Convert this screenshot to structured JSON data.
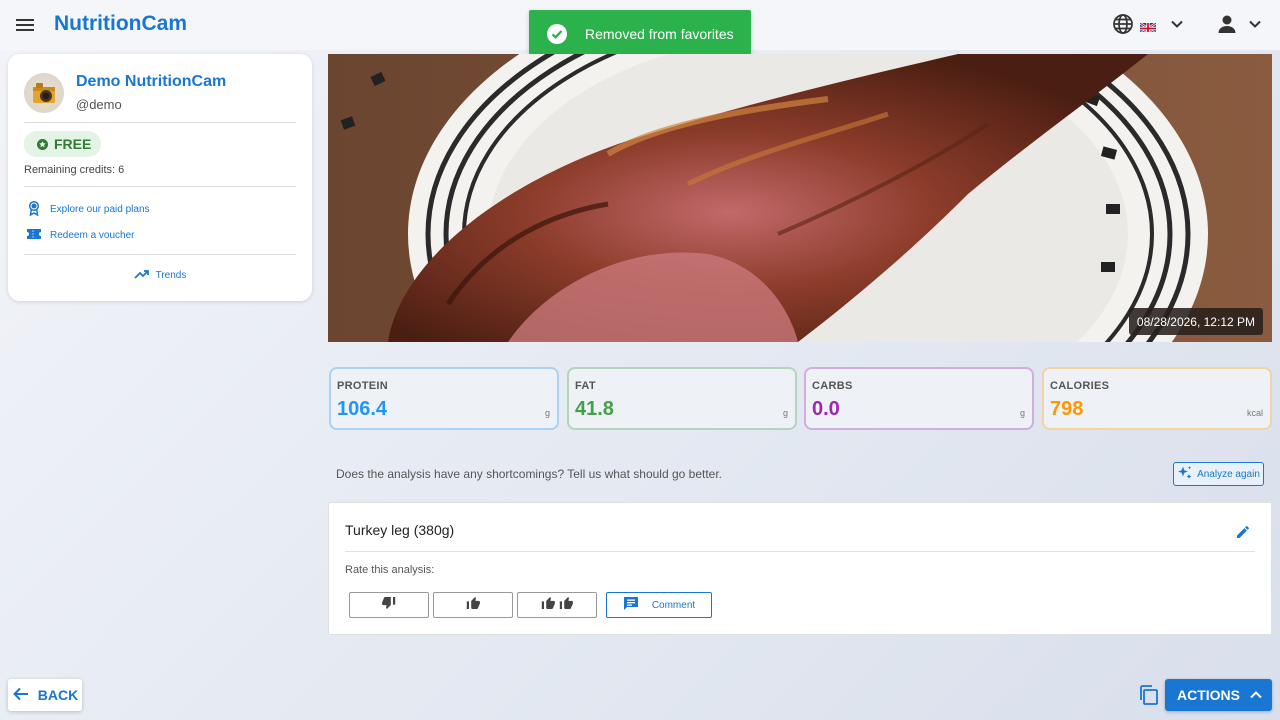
{
  "app": {
    "brand": "NutritionCam"
  },
  "toast": {
    "message": "Removed from favorites",
    "color": "#2bb24c"
  },
  "header": {
    "language_icon": "globe-icon",
    "language_flag": "uk-flag",
    "account_icon": "person-icon"
  },
  "profile": {
    "name": "Demo NutritionCam",
    "handle": "@demo",
    "plan": "FREE",
    "credits": "Remaining credits: 6",
    "links": [
      {
        "label": "Explore our paid plans",
        "icon": "award-icon"
      },
      {
        "label": "Redeem a voucher",
        "icon": "ticket-icon"
      }
    ],
    "trends": "Trends"
  },
  "photo": {
    "timestamp": "08/28/2026, 12:12 PM"
  },
  "macros": [
    {
      "label": "PROTEIN",
      "value": "106.4",
      "unit": "g",
      "color": "#2196f3"
    },
    {
      "label": "FAT",
      "value": "41.8",
      "unit": "g",
      "color": "#43a047"
    },
    {
      "label": "CARBS",
      "value": "0.0",
      "unit": "g",
      "color": "#9c27b0"
    },
    {
      "label": "CALORIES",
      "value": "798",
      "unit": "kcal",
      "color": "#ff9800"
    }
  ],
  "feedback": {
    "prompt": "Does the analysis have any shortcomings? Tell us what should go better.",
    "analyze_again": "Analyze again"
  },
  "result": {
    "food": "Turkey leg (380g)",
    "rate_label": "Rate this analysis:",
    "rating_buttons": [
      "thumbs-down",
      "thumbs-up",
      "double-thumbs-up"
    ],
    "comment": "Comment"
  },
  "footer": {
    "back": "BACK",
    "actions": "ACTIONS"
  },
  "colors": {
    "primary": "#1976d2"
  }
}
